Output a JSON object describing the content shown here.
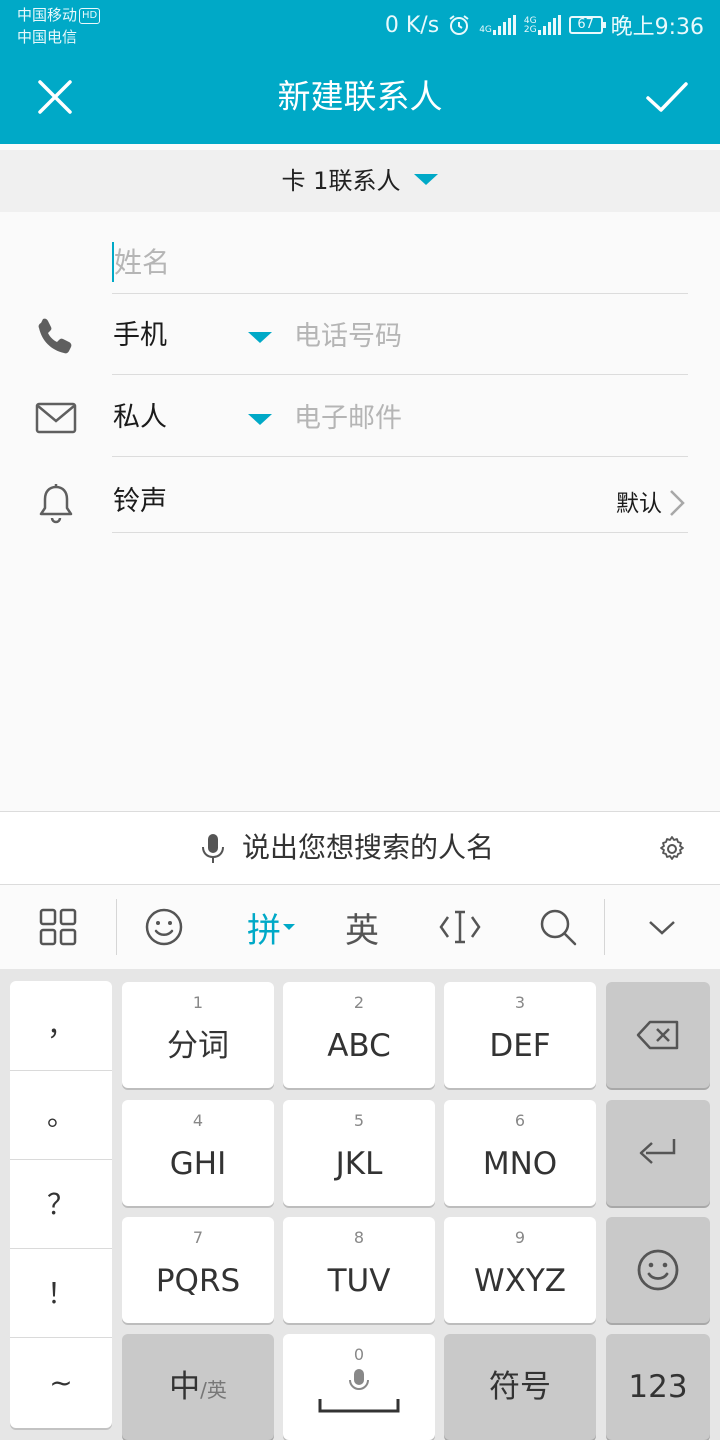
{
  "status": {
    "carrier1": "中国移动",
    "hd_badge": "HD",
    "carrier2": "中国电信",
    "net_speed": "0 K/s",
    "net1": "4G",
    "net2a": "4G",
    "net2b": "2G",
    "battery": "67",
    "time": "晚上9:36"
  },
  "appbar": {
    "title": "新建联系人",
    "close_icon": "close-icon",
    "confirm_icon": "check-icon",
    "color": "#00a9c7"
  },
  "account": {
    "label": "卡 1联系人"
  },
  "form": {
    "name_placeholder": "姓名",
    "phone": {
      "type": "手机",
      "placeholder": "电话号码",
      "icon": "phone-icon"
    },
    "email": {
      "type": "私人",
      "placeholder": "电子邮件",
      "icon": "mail-icon"
    },
    "ringtone": {
      "label": "铃声",
      "value": "默认",
      "icon": "bell-icon"
    }
  },
  "voice_search": {
    "text": "说出您想搜索的人名"
  },
  "ime_toolbar": {
    "pinyin": "拼",
    "english": "英"
  },
  "keyboard": {
    "side_keys": [
      "，",
      "。",
      "？",
      "！",
      "~"
    ],
    "keys": [
      {
        "num": "1",
        "label": "分词"
      },
      {
        "num": "2",
        "label": "ABC"
      },
      {
        "num": "3",
        "label": "DEF"
      },
      {
        "num": "4",
        "label": "GHI"
      },
      {
        "num": "5",
        "label": "JKL"
      },
      {
        "num": "6",
        "label": "MNO"
      },
      {
        "num": "7",
        "label": "PQRS"
      },
      {
        "num": "8",
        "label": "TUV"
      },
      {
        "num": "9",
        "label": "WXYZ"
      }
    ],
    "space_num": "0",
    "lang_main": "中",
    "lang_sub": "/英",
    "symbols": "符号",
    "numbers": "123"
  }
}
